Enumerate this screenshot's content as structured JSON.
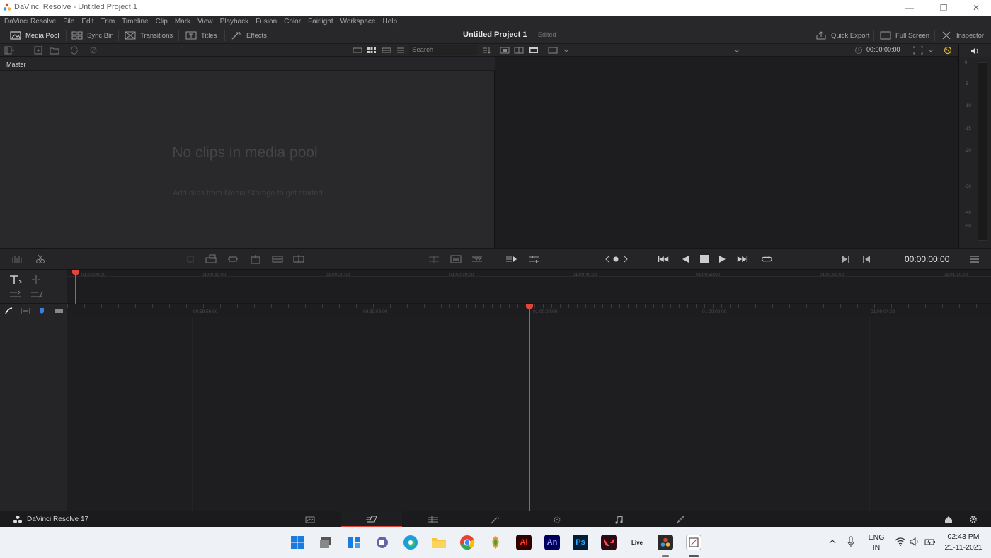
{
  "window": {
    "title": "DaVinci Resolve - Untitled Project 1"
  },
  "menu": [
    "DaVinci Resolve",
    "File",
    "Edit",
    "Trim",
    "Timeline",
    "Clip",
    "Mark",
    "View",
    "Playback",
    "Fusion",
    "Color",
    "Fairlight",
    "Workspace",
    "Help"
  ],
  "toolbar": {
    "media_pool": "Media Pool",
    "sync_bin": "Sync Bin",
    "transitions": "Transitions",
    "titles": "Titles",
    "effects": "Effects",
    "project_title": "Untitled Project 1",
    "project_status": "Edited",
    "quick_export": "Quick Export",
    "full_screen": "Full Screen",
    "inspector": "Inspector"
  },
  "subbar": {
    "search_placeholder": "Search",
    "viewer_timecode": "00:00:00:00"
  },
  "media_pool": {
    "bin": "Master",
    "empty_title": "No clips in media pool",
    "empty_subtitle": "Add clips from Media Storage to get started"
  },
  "audio_meter": {
    "labels": [
      "0",
      "-5",
      "-10",
      "-15",
      "-20",
      "-30",
      "-40",
      "-50"
    ]
  },
  "transport": {
    "timecode": "00:00:00:00"
  },
  "timeline": {
    "upper_ticks": [
      "01:00:00:00",
      "01:00:10:00",
      "01:00:20:00",
      "01:00:30:00",
      "01:00:40:00",
      "01:00:50:00",
      "01:01:00:00",
      "01:01:10:00"
    ],
    "lower_ticks": [
      "00:59:56:00",
      "00:59:58:00",
      "01:00:00:00",
      "01:00:02:00",
      "01:00:04:00"
    ]
  },
  "pagebar": {
    "app_name": "DaVinci Resolve 17"
  },
  "taskbar": {
    "lang_line1": "ENG",
    "lang_line2": "IN",
    "time": "02:43 PM",
    "date": "21-11-2021",
    "apps": [
      "Ai",
      "An",
      "Ps",
      "Live"
    ]
  },
  "colors": {
    "accent": "#e2453c",
    "panel": "#28282a",
    "taskbar": "#eef1f6"
  }
}
